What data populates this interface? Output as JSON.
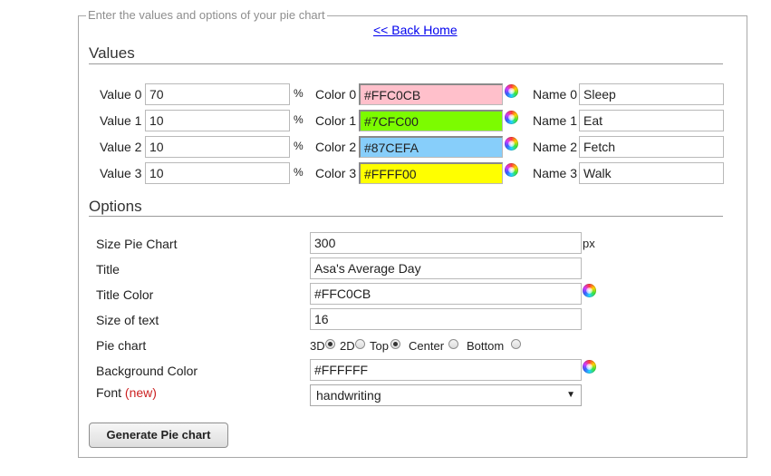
{
  "legend": "Enter the values and options of your pie chart",
  "back_link": "<< Back Home",
  "values_section": {
    "title": "Values",
    "rows": [
      {
        "value_label": "Value 0",
        "value": "70",
        "pct": "%",
        "color_label": "Color 0",
        "color": "#FFC0CB",
        "name_label": "Name 0",
        "name": "Sleep"
      },
      {
        "value_label": "Value 1",
        "value": "10",
        "pct": "%",
        "color_label": "Color 1",
        "color": "#7CFC00",
        "name_label": "Name 1",
        "name": "Eat"
      },
      {
        "value_label": "Value 2",
        "value": "10",
        "pct": "%",
        "color_label": "Color 2",
        "color": "#87CEFA",
        "name_label": "Name 2",
        "name": "Fetch"
      },
      {
        "value_label": "Value 3",
        "value": "10",
        "pct": "%",
        "color_label": "Color 3",
        "color": "#FFFF00",
        "name_label": "Name 3",
        "name": "Walk"
      }
    ]
  },
  "options_section": {
    "title": "Options",
    "size_label": "Size Pie Chart",
    "size_value": "300",
    "size_unit": "px",
    "title_label": "Title",
    "title_value": "Asa's Average Day",
    "title_color_label": "Title Color",
    "title_color_value": "#FFC0CB",
    "text_size_label": "Size of text",
    "text_size_value": "16",
    "pie_chart_label": "Pie chart",
    "radio_3d": "3D",
    "radio_2d": "2D",
    "radio_top": "Top",
    "radio_center": "Center",
    "radio_bottom": "Bottom",
    "selected_dimension": "3D",
    "selected_position": "Top",
    "bg_color_label": "Background Color",
    "bg_color_value": "#FFFFFF",
    "font_label": "Font",
    "font_new_tag": "(new)",
    "font_value": "handwriting"
  },
  "generate_button": "Generate Pie chart",
  "colors": {
    "link": "#0000EE",
    "new_tag": "#CC2222",
    "row_color_0": "#FFC0CB",
    "row_color_1": "#7CFC00",
    "row_color_2": "#87CEFA",
    "row_color_3": "#FFFF00"
  }
}
